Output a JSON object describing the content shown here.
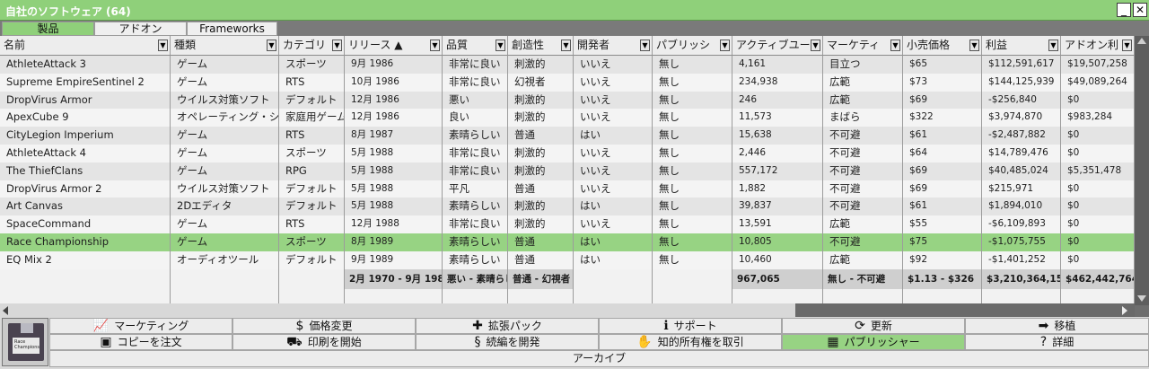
{
  "window": {
    "title": "自社のソフトウェア",
    "count": "(64)",
    "minimize": "_",
    "close": "✕"
  },
  "tabs": [
    {
      "label": "製品",
      "active": true
    },
    {
      "label": "アドオン",
      "active": false
    },
    {
      "label": "Frameworks",
      "active": false
    }
  ],
  "table": {
    "columns": [
      {
        "label": "名前"
      },
      {
        "label": "種類"
      },
      {
        "label": "カテゴリ"
      },
      {
        "label": "リリース ▲"
      },
      {
        "label": "品質"
      },
      {
        "label": "創造性"
      },
      {
        "label": "開発者"
      },
      {
        "label": "パブリッシ"
      },
      {
        "label": "アクティブユー"
      },
      {
        "label": "マーケティ"
      },
      {
        "label": "小売価格"
      },
      {
        "label": "利益"
      },
      {
        "label": "アドオン利"
      }
    ],
    "filter_glyph": "▼",
    "selected_row": 10,
    "rows": [
      [
        "AthleteAttack 3",
        "ゲーム",
        "スポーツ",
        "9月 1986",
        "非常に良い",
        "刺激的",
        "いいえ",
        "無し",
        "4,161",
        "目立つ",
        "$65",
        "$112,591,617",
        "$19,507,258"
      ],
      [
        "Supreme EmpireSentinel 2",
        "ゲーム",
        "RTS",
        "10月 1986",
        "非常に良い",
        "幻視者",
        "いいえ",
        "無し",
        "234,938",
        "広範",
        "$73",
        "$144,125,939",
        "$49,089,264"
      ],
      [
        "DropVirus Armor",
        "ウイルス対策ソフト",
        "デフォルト",
        "12月 1986",
        "悪い",
        "刺激的",
        "いいえ",
        "無し",
        "246",
        "広範",
        "$69",
        "-$256,840",
        "$0"
      ],
      [
        "ApexCube 9",
        "オペレーティング・シ",
        "家庭用ゲーム",
        "12月 1986",
        "良い",
        "刺激的",
        "いいえ",
        "無し",
        "11,573",
        "まばら",
        "$322",
        "$3,974,870",
        "$983,284"
      ],
      [
        "CityLegion Imperium",
        "ゲーム",
        "RTS",
        "8月 1987",
        "素晴らしい",
        "普通",
        "はい",
        "無し",
        "15,638",
        "不可避",
        "$61",
        "-$2,487,882",
        "$0"
      ],
      [
        "AthleteAttack 4",
        "ゲーム",
        "スポーツ",
        "5月 1988",
        "非常に良い",
        "刺激的",
        "いいえ",
        "無し",
        "2,446",
        "不可避",
        "$64",
        "$14,789,476",
        "$0"
      ],
      [
        "The ThiefClans",
        "ゲーム",
        "RPG",
        "5月 1988",
        "非常に良い",
        "刺激的",
        "いいえ",
        "無し",
        "557,172",
        "不可避",
        "$69",
        "$40,485,024",
        "$5,351,478"
      ],
      [
        "DropVirus Armor 2",
        "ウイルス対策ソフト",
        "デフォルト",
        "5月 1988",
        "平凡",
        "普通",
        "いいえ",
        "無し",
        "1,882",
        "不可避",
        "$69",
        "$215,971",
        "$0"
      ],
      [
        "Art Canvas",
        "2Dエディタ",
        "デフォルト",
        "5月 1988",
        "素晴らしい",
        "刺激的",
        "はい",
        "無し",
        "39,837",
        "不可避",
        "$61",
        "$1,894,010",
        "$0"
      ],
      [
        "SpaceCommand",
        "ゲーム",
        "RTS",
        "12月 1988",
        "非常に良い",
        "刺激的",
        "いいえ",
        "無し",
        "13,591",
        "広範",
        "$55",
        "-$6,109,893",
        "$0"
      ],
      [
        "Race Championship",
        "ゲーム",
        "スポーツ",
        "8月 1989",
        "素晴らしい",
        "普通",
        "はい",
        "無し",
        "10,805",
        "不可避",
        "$75",
        "-$1,075,755",
        "$0"
      ],
      [
        "EQ Mix 2",
        "オーディオツール",
        "デフォルト",
        "9月 1989",
        "素晴らしい",
        "普通",
        "はい",
        "無し",
        "10,460",
        "広範",
        "$92",
        "-$1,401,252",
        "$0"
      ]
    ],
    "summary": [
      "",
      "",
      "",
      "2月 1970 - 9月 1989",
      "悪い - 素晴らしい",
      "普通 - 幻視者",
      "",
      "",
      "967,065",
      "無し - 不可避",
      "$1.13 - $326",
      "$3,210,364,151",
      "$462,442,764"
    ]
  },
  "actions": {
    "row1": [
      {
        "label": "マーケティング",
        "icon": "chart-icon",
        "glyph": "📈"
      },
      {
        "label": "価格変更",
        "icon": "dollar-icon",
        "glyph": "$"
      },
      {
        "label": "拡張パック",
        "icon": "puzzle-icon",
        "glyph": "✚"
      },
      {
        "label": "サポート",
        "icon": "info-icon",
        "glyph": "ℹ"
      },
      {
        "label": "更新",
        "icon": "refresh-icon",
        "glyph": "⟳"
      },
      {
        "label": "移植",
        "icon": "arrow-right-icon",
        "glyph": "➡"
      }
    ],
    "row2": [
      {
        "label": "コピーを注文",
        "icon": "box-icon",
        "glyph": "▣"
      },
      {
        "label": "印刷を開始",
        "icon": "truck-icon",
        "glyph": "⛟"
      },
      {
        "label": "続編を開発",
        "icon": "dna-icon",
        "glyph": "§"
      },
      {
        "label": "知的所有権を取引",
        "icon": "handshake-icon",
        "glyph": "✋"
      },
      {
        "label": "パブリッシャー",
        "icon": "building-icon",
        "glyph": "▦",
        "active": true
      },
      {
        "label": "詳細",
        "icon": "question-icon",
        "glyph": "?"
      }
    ],
    "archive": "アーカイブ"
  },
  "thumbnail": {
    "label": "Race Championship"
  }
}
